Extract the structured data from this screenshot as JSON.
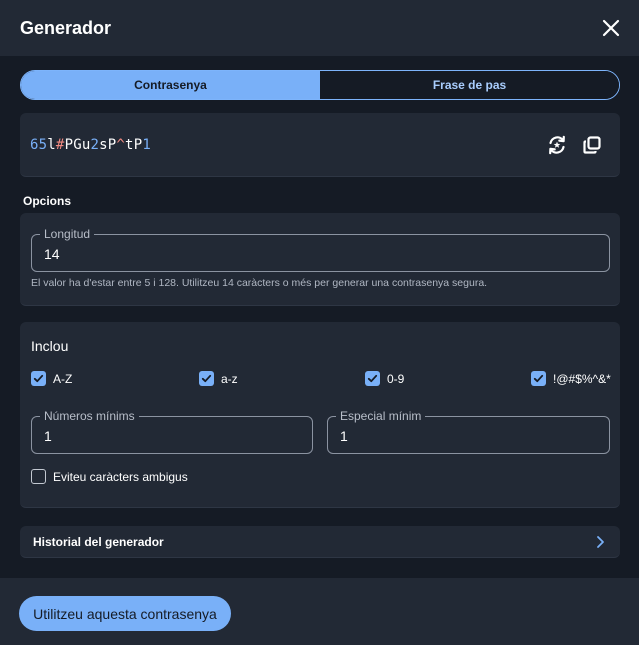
{
  "header": {
    "title": "Generador"
  },
  "tabs": [
    {
      "label": "Contrasenya",
      "active": true
    },
    {
      "label": "Frase de pas",
      "active": false
    }
  ],
  "password": {
    "chars": [
      {
        "c": "6",
        "t": "num"
      },
      {
        "c": "5",
        "t": "num"
      },
      {
        "c": "l",
        "t": "let"
      },
      {
        "c": "#",
        "t": "sym"
      },
      {
        "c": "P",
        "t": "let"
      },
      {
        "c": "G",
        "t": "let"
      },
      {
        "c": "u",
        "t": "let"
      },
      {
        "c": "2",
        "t": "num"
      },
      {
        "c": "s",
        "t": "let"
      },
      {
        "c": "P",
        "t": "let"
      },
      {
        "c": "^",
        "t": "sym"
      },
      {
        "c": "t",
        "t": "let"
      },
      {
        "c": "P",
        "t": "let"
      },
      {
        "c": "1",
        "t": "num"
      }
    ]
  },
  "options": {
    "section_label": "Opcions",
    "length_label": "Longitud",
    "length_value": "14",
    "length_hint": "El valor ha d'estar entre 5 i 128. Utilitzeu 14 caràcters o més per generar una contrasenya segura."
  },
  "include": {
    "title": "Inclou",
    "uppercase": {
      "label": "A-Z",
      "checked": true
    },
    "lowercase": {
      "label": "a-z",
      "checked": true
    },
    "numbers": {
      "label": "0-9",
      "checked": true
    },
    "special": {
      "label": "!@#$%^&*",
      "checked": true
    },
    "min_numbers_label": "Números mínims",
    "min_numbers_value": "1",
    "min_special_label": "Especial mínim",
    "min_special_value": "1",
    "avoid_ambiguous": {
      "label": "Eviteu caràcters ambigus",
      "checked": false
    }
  },
  "history": {
    "label": "Historial del generador"
  },
  "footer": {
    "use_button": "Utilitzeu aquesta contrasenya"
  },
  "colors": {
    "accent": "#79b0f8",
    "background": "#151b25",
    "card": "#222935",
    "symbol": "#f28b82"
  }
}
